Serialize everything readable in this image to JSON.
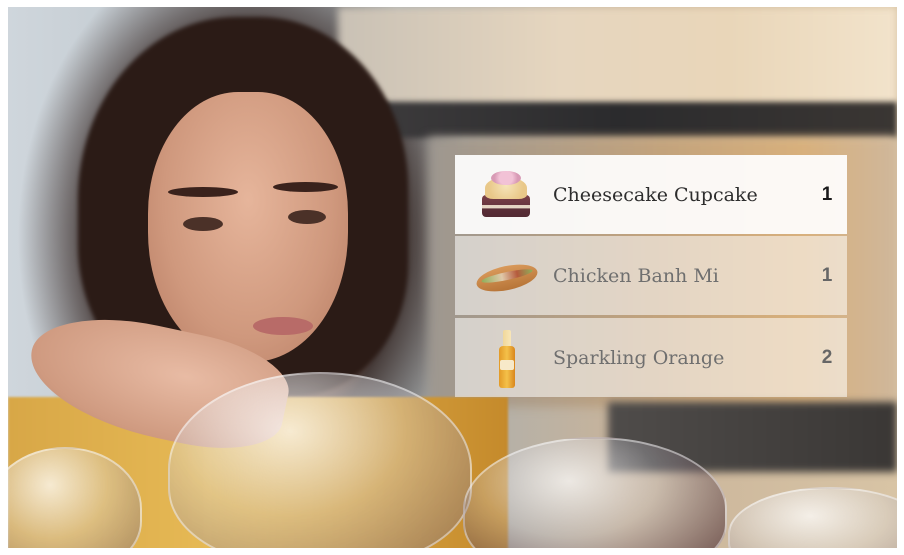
{
  "scene": {
    "items": [
      {
        "name": "Cheesecake Cupcake",
        "quantity": "1",
        "icon": "cupcake-icon"
      },
      {
        "name": "Chicken Banh Mi",
        "quantity": "1",
        "icon": "sandwich-icon"
      },
      {
        "name": "Sparkling Orange",
        "quantity": "2",
        "icon": "bottle-icon"
      }
    ]
  }
}
